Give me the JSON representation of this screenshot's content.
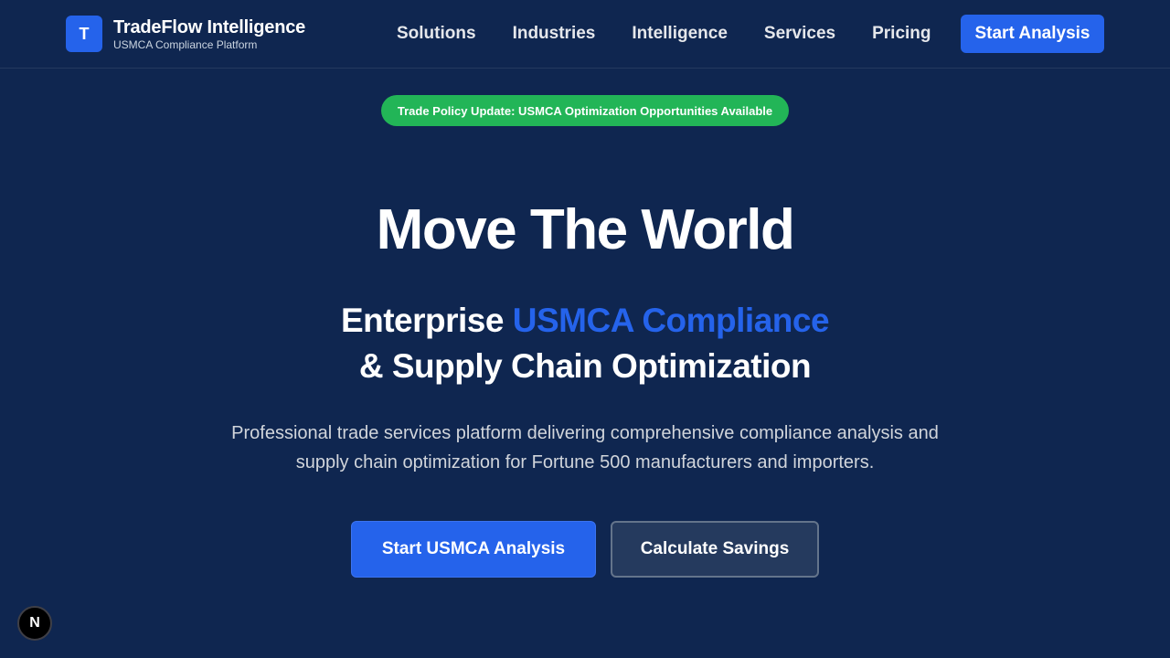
{
  "header": {
    "logo_letter": "T",
    "brand_name": "TradeFlow Intelligence",
    "brand_sub": "USMCA Compliance Platform",
    "nav": [
      "Solutions",
      "Industries",
      "Intelligence",
      "Services",
      "Pricing"
    ],
    "cta_label": "Start Analysis"
  },
  "alert": {
    "text": "Trade Policy Update: USMCA Optimization Opportunities Available"
  },
  "hero": {
    "title": "Move The World",
    "sub_line1_prefix": "Enterprise ",
    "sub_line1_accent": "USMCA Compliance",
    "sub_line2": "& Supply Chain Optimization",
    "description": "Professional trade services platform delivering comprehensive compliance analysis and supply chain optimization for Fortune 500 manufacturers and importers.",
    "primary_button": "Start USMCA Analysis",
    "secondary_button": "Calculate Savings"
  },
  "dev_badge": {
    "letter": "N"
  },
  "colors": {
    "background": "#0f2650",
    "accent": "#2563eb",
    "success": "#22b557"
  }
}
